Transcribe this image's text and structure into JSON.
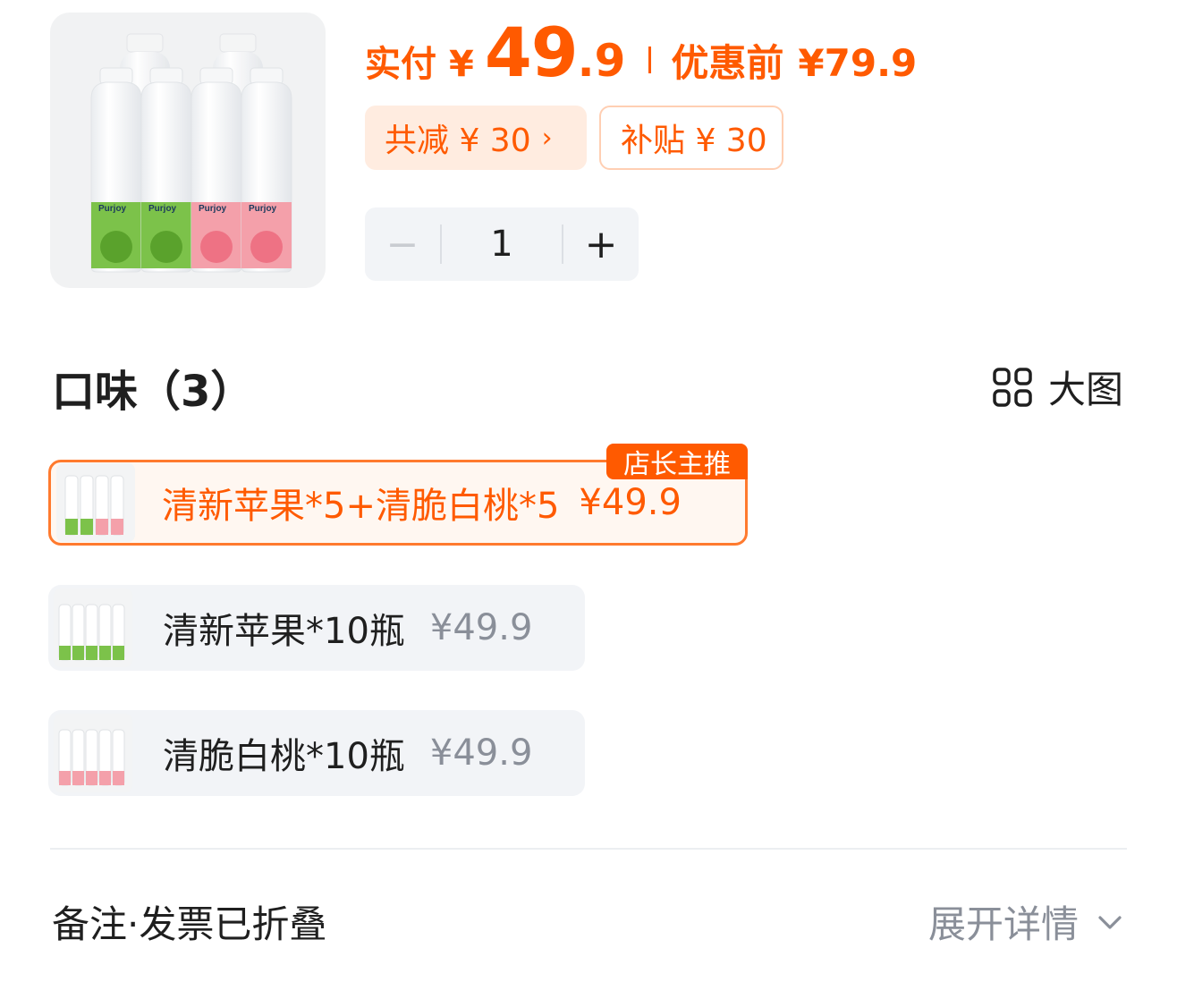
{
  "product": {
    "image_icon": "yogurt-bottles-image",
    "bottle_brand": "Purjoy",
    "colors": {
      "accent": "#ff5a00",
      "apple": "#6fbf3a",
      "peach": "#f27a8a"
    }
  },
  "price": {
    "paid_label": "实付",
    "currency": "¥",
    "amount_int": "49",
    "amount_dec": ".9",
    "original_label": "优惠前",
    "original_price": "¥79.9"
  },
  "discounts": {
    "total_reduction": "共减 ¥ 30",
    "total_reduction_arrow": "›",
    "subsidy": "补贴 ¥ 30"
  },
  "quantity": {
    "minus": "−",
    "value": "1",
    "plus": "+"
  },
  "flavor": {
    "title": "口味（3）",
    "big_view_icon": "grid-icon",
    "big_view_label": "大图",
    "options": [
      {
        "name": "清新苹果*5+清脆白桃*5",
        "price": "¥49.9",
        "badge": "店长主推",
        "selected": true,
        "thumb": "mixed"
      },
      {
        "name": "清新苹果*10瓶",
        "price": "¥49.9",
        "selected": false,
        "thumb": "apple"
      },
      {
        "name": "清脆白桃*10瓶",
        "price": "¥49.9",
        "selected": false,
        "thumb": "peach"
      }
    ]
  },
  "footer": {
    "notes_label": "备注·发票已折叠",
    "expand_label": "展开详情",
    "expand_icon": "chevron-down-icon"
  }
}
